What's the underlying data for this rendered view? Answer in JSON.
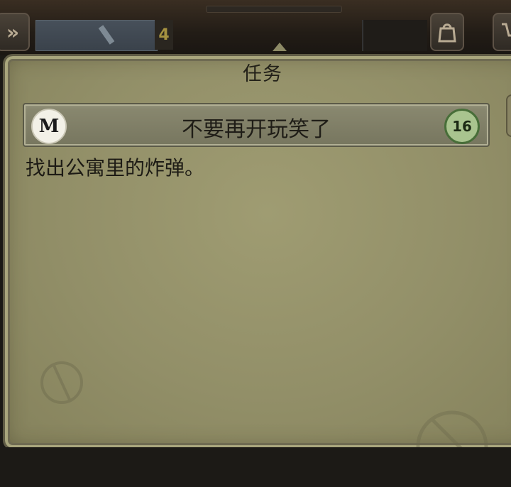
{
  "hud": {
    "left_button_icon": "double-chevron-right-icon",
    "counter": "4",
    "bag_icon": "bag-icon",
    "cart_icon": "cart-icon"
  },
  "panel": {
    "title": "任务",
    "quest": {
      "badge": "M",
      "name": "不要再开玩笑了",
      "level": "16",
      "description": "找出公寓里的炸弹。"
    }
  },
  "colors": {
    "parchment": "#928f68",
    "bar": "#807f66",
    "level_badge": "#a9c48f"
  }
}
